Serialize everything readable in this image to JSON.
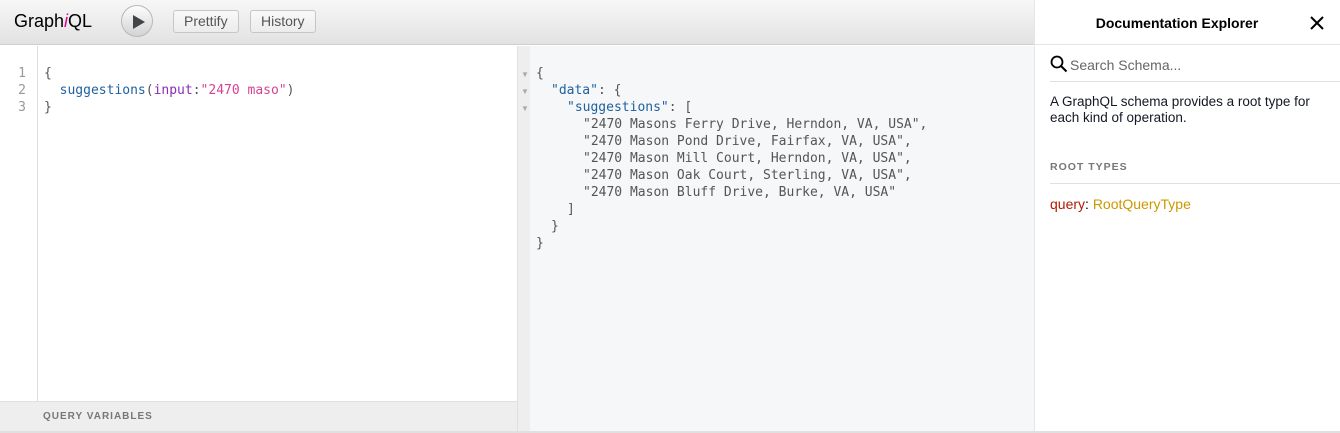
{
  "header": {
    "logo_prefix": "Graph",
    "logo_i": "i",
    "logo_suffix": "QL",
    "prettify_label": "Prettify",
    "history_label": "History"
  },
  "query_editor": {
    "line_numbers": [
      "1",
      "2",
      "3"
    ],
    "line1": "{",
    "line2_field": "suggestions",
    "line2_paren_open": "(",
    "line2_arg": "input",
    "line2_colon": ":",
    "line2_value": "\"2470 maso\"",
    "line2_paren_close": ")",
    "line3": "}"
  },
  "variables_bar": {
    "label": "QUERY VARIABLES"
  },
  "result": {
    "open_brace": "{",
    "data_key": "\"data\"",
    "data_sep": ": {",
    "suggestions_key": "\"suggestions\"",
    "suggestions_sep": ": [",
    "items": [
      "\"2470 Masons Ferry Drive, Herndon, VA, USA\",",
      "\"2470 Mason Pond Drive, Fairfax, VA, USA\",",
      "\"2470 Mason Mill Court, Herndon, VA, USA\",",
      "\"2470 Mason Oak Court, Sterling, VA, USA\",",
      "\"2470 Mason Bluff Drive, Burke, VA, USA\""
    ],
    "close_bracket": "]",
    "close_brace_inner": "}",
    "close_brace_outer": "}"
  },
  "docs": {
    "title": "Documentation Explorer",
    "search_placeholder": "Search Schema...",
    "description": "A GraphQL schema provides a root type for each kind of operation.",
    "section_title": "ROOT TYPES",
    "root_keyword": "query",
    "root_colon": ": ",
    "root_type": "RootQueryType"
  },
  "icons": {
    "run": "play-icon",
    "close": "close-icon",
    "search": "search-icon",
    "fold": "fold-arrow-icon"
  },
  "colors": {
    "field": "#1f61a0",
    "argument": "#8b2bb9",
    "string": "#d64292",
    "keyword": "#b11a04",
    "type_name": "#ca9800",
    "logo_accent": "#e10098"
  }
}
